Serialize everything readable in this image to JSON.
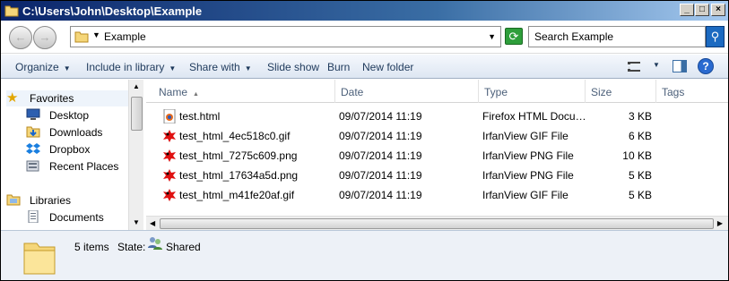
{
  "window": {
    "title": "C:\\Users\\John\\Desktop\\Example",
    "minimize": "_",
    "maximize": "□",
    "close": "×"
  },
  "address": {
    "path": "Example",
    "search_placeholder": "Search Example"
  },
  "toolbar": {
    "organize": "Organize",
    "include_in_library": "Include in library",
    "share_with": "Share with",
    "slide_show": "Slide show",
    "burn": "Burn",
    "new_folder": "New folder",
    "help": "?"
  },
  "nav": {
    "favorites": "Favorites",
    "desktop": "Desktop",
    "downloads": "Downloads",
    "dropbox": "Dropbox",
    "recent_places": "Recent Places",
    "libraries": "Libraries",
    "documents": "Documents"
  },
  "columns": {
    "name": "Name",
    "date": "Date",
    "type": "Type",
    "size": "Size",
    "tags": "Tags"
  },
  "files": [
    {
      "name": "test.html",
      "date": "09/07/2014 11:19",
      "type": "Firefox HTML Docu…",
      "size": "3 KB",
      "icon": "firefox-html-icon"
    },
    {
      "name": "test_html_4ec518c0.gif",
      "date": "09/07/2014 11:19",
      "type": "IrfanView GIF File",
      "size": "6 KB",
      "icon": "irfanview-icon"
    },
    {
      "name": "test_html_7275c609.png",
      "date": "09/07/2014 11:19",
      "type": "IrfanView PNG File",
      "size": "10 KB",
      "icon": "irfanview-icon"
    },
    {
      "name": "test_html_17634a5d.png",
      "date": "09/07/2014 11:19",
      "type": "IrfanView PNG File",
      "size": "5 KB",
      "icon": "irfanview-icon"
    },
    {
      "name": "test_html_m41fe20af.gif",
      "date": "09/07/2014 11:19",
      "type": "IrfanView GIF File",
      "size": "5 KB",
      "icon": "irfanview-icon"
    }
  ],
  "details": {
    "count": "5 items",
    "state_label": "State:",
    "state_value": "Shared"
  },
  "colors": {
    "toolbar_text": "#1e395b",
    "title_gradient_start": "#0a246a",
    "irfanview_red": "#e01010"
  }
}
